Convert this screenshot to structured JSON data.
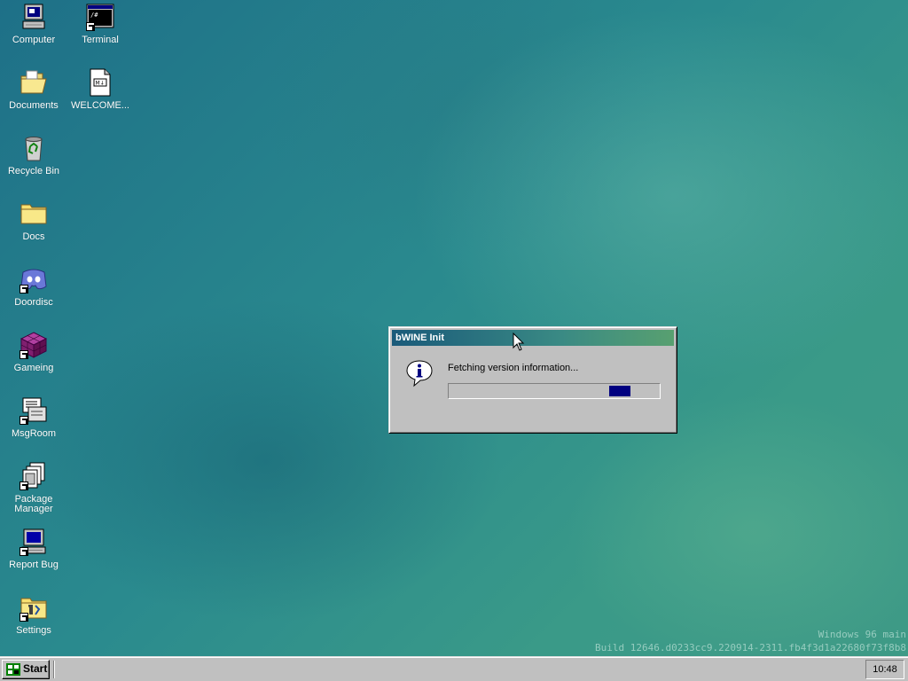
{
  "desktop": {
    "icons": [
      {
        "label": "Computer"
      },
      {
        "label": "Terminal"
      },
      {
        "label": "Documents"
      },
      {
        "label": "WELCOME..."
      },
      {
        "label": "Recycle Bin"
      },
      {
        "label": "Docs"
      },
      {
        "label": "Doordisc"
      },
      {
        "label": "Gameing"
      },
      {
        "label": "MsgRoom"
      },
      {
        "label": "Package Manager"
      },
      {
        "label": "Report Bug"
      },
      {
        "label": "Settings"
      }
    ]
  },
  "dialog": {
    "title": "bWINE Init",
    "message": "Fetching version information...",
    "icon": "info-icon",
    "progress": {
      "mode": "indeterminate",
      "block_position_percent": 85
    }
  },
  "watermark": {
    "line1": "Windows 96 main",
    "line2": "Build 12646.d0233cc9.220914-2311.fb4f3d1a22680f73f8b8"
  },
  "taskbar": {
    "start_label": "Start",
    "clock": "10:48"
  },
  "colors": {
    "titlebar_start": "#1a5a7a",
    "titlebar_end": "#58a070",
    "progress_block": "#000080",
    "window_face": "#c0c0c0"
  }
}
